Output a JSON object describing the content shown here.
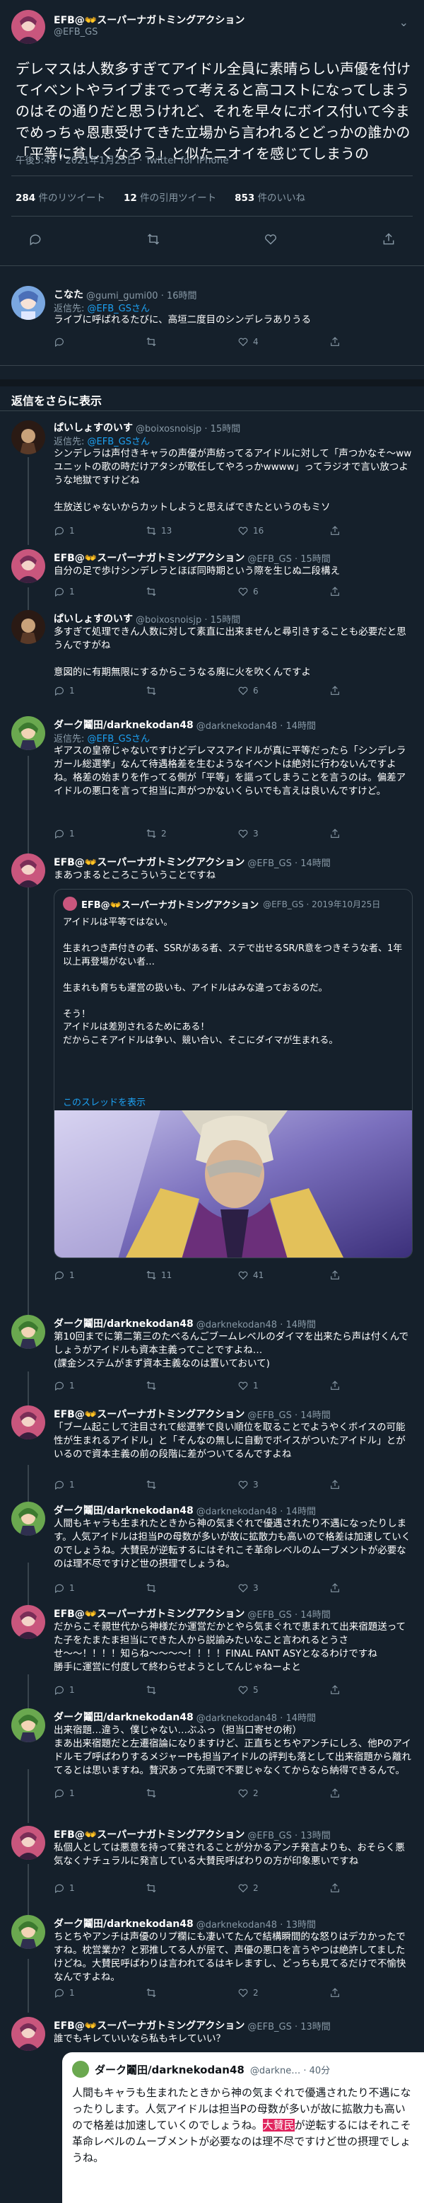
{
  "main": {
    "name": "EFB@👐スーパーナガトミングアクション",
    "handle": "@EFB_GS",
    "text": "デレマスは人数多すぎてアイドル全員に素晴らしい声優を付けてイベントやライブまでって考えると高コストになってしまうのはその通りだと思うけれど、それを早々にボイス付いて今までめっちゃ恩恵受けてきた立場から言われるとどっかの誰かの「平等に貧しくなろう」と似たニオイを感じてしまうの",
    "time": "午後3:40 · 2021年1月25日 · Twitter for iPhone",
    "retweets": "284",
    "retweets_label": "件のリツイート",
    "quotes": "12",
    "quotes_label": "件の引用ツイート",
    "likes": "853",
    "likes_label": "件のいいね"
  },
  "section_title": "返信をさらに表示",
  "replies": [
    {
      "name": "こなた",
      "handle": "@gumi_gumi00 · 16時間",
      "reply_to_label": "返信先:",
      "reply_to": "@EFB_GSさん",
      "text": "ライブに呼ばれるたびに、高垣二度目のシンデレラありうる",
      "reply_count": "",
      "rt_count": "",
      "like_count": "4"
    },
    {
      "name": "ぱいしょすのいす",
      "handle": "@boixosnoisjp · 15時間",
      "reply_to_label": "返信先:",
      "reply_to": "@EFB_GSさん",
      "text": "シンデレラは声付きキャラの声優が声紡ってるアイドルに対して「声つかなそ〜ww ユニットの歌の時だけアタシが歌任してやろっかwwww」ってラジオで言い放つような地獄ですけどね\n\n生放送じゃないからカットしようと思えばできたというのもミソ",
      "reply_count": "1",
      "rt_count": "13",
      "like_count": "16"
    },
    {
      "name": "EFB@👐スーパーナガトミングアクション",
      "handle": "@EFB_GS · 15時間",
      "text": "自分の足で歩けシンデレラとほぼ同時期という際を生じぬ二段構え",
      "reply_count": "1",
      "rt_count": "",
      "like_count": "6"
    },
    {
      "name": "ぱいしょすのいす",
      "handle": "@boixosnoisjp · 15時間",
      "text": "多すぎて処理できん人数に対して素直に出来ませんと尋引きすることも必要だと思うんですがね\n\n意図的に有期無限にするからこうなる廃に火を吹くんですよ",
      "reply_count": "1",
      "rt_count": "",
      "like_count": "6"
    },
    {
      "name": "ダーク鬮田/darknekodan48",
      "handle": "@darknekodan48 · 14時間",
      "reply_to_label": "返信先:",
      "reply_to": "@EFB_GSさん",
      "text": "ギアスの皇帝じゃないですけどデレマスアイドルが真に平等だったら「シンデレラガール総選挙」なんて待遇格差を生むようなイベントは絶対に行わないんですよね。格差の始まりを作ってる側が「平等」を謳ってしまうことを言うのは。偏差アイドルの悪口を言って担当に声がつかないくらいでも言えは良いんですけど。",
      "reply_count": "1",
      "rt_count": "2",
      "like_count": "3"
    },
    {
      "name": "EFB@👐スーパーナガトミングアクション",
      "handle": "@EFB_GS · 14時間",
      "text": "まあつまるところこういうことですね",
      "quote": {
        "name": "EFB@👐スーパーナガトミングアクション",
        "handle": "@EFB_GS · 2019年10月25日",
        "text": "アイドルは平等ではない。\n\n生まれつき声付きの者、SSRがある者、ステで出せるSR/R意をつきそうな者、1年以上再登場がない者…\n\n生まれも育ちも運営の扱いも、アイドルはみな違っておるのだ。\n\nそう！\nアイドルは差別されるためにある！\nだからこそアイドルは争い、競い合い、そこにダイマが生まれる。",
        "thread_link": "このスレッドを表示"
      },
      "reply_count": "1",
      "rt_count": "11",
      "like_count": "41"
    },
    {
      "name": "ダーク鬮田/darknekodan48",
      "handle": "@darknekodan48 · 14時間",
      "text": "第10回までに第二第三のたべるんごブームレベルのダイマを出来たら声は付くんでしょうがアイドルも資本主義ってことですよね…\n(課金システムがまず資本主義なのは置いておいて)",
      "reply_count": "1",
      "rt_count": "",
      "like_count": "1"
    },
    {
      "name": "EFB@👐スーパーナガトミングアクション",
      "handle": "@EFB_GS · 14時間",
      "text": "「ブーム起こして注目されて総選挙で良い順位を取ることでようやくボイスの可能性が生まれるアイドル」と「そんなの無しに自動でボイスがついたアイドル」とがいるので資本主義の前の段階に差がついてるんですよね",
      "reply_count": "1",
      "rt_count": "",
      "like_count": "3"
    },
    {
      "name": "ダーク鬮田/darknekodan48",
      "handle": "@darknekodan48 · 14時間",
      "text": "人間もキャラも生まれたときから神の気まぐれで優遇されたり不遇になったりします。人気アイドルは担当Pの母数が多いが故に拡散力も高いので格差は加速していくのでしょうね。大賛民が逆転するにはそれこそ革命レベルのムーブメントが必要なのは理不尽ですけど世の摂理でしょうね。",
      "reply_count": "1",
      "rt_count": "",
      "like_count": "3"
    },
    {
      "name": "EFB@👐スーパーナガトミングアクション",
      "handle": "@EFB_GS · 14時間",
      "text": "だからこそ親世代から神様だか運営だかとやら気まぐれで恵まれて出来宿題送ってた子をたまたま担当にできた人から説諭みたいなこと言われるとうさせ〜〜！！！！知らね〜〜〜〜！！！！FINAL FANT ASYとなるわけですね\n勝手に運営に付度して終わらせようとしてんじゃねーよと",
      "reply_count": "1",
      "rt_count": "",
      "like_count": "5"
    },
    {
      "name": "ダーク鬮田/darknekodan48",
      "handle": "@darknekodan48 · 14時間",
      "text": "出来宿題…違う、僕じゃない…ぶふっ（担当口寄せの術）\nまあ出来宿題だと左遷宿論になりますけど、正直ちとちやアンチにしろ、他Pのアイドルモブ呼ばわりするメジャーPも担当アイドルの評判も落として出来宿題から離れてるとは思いますね。贅沢あって先頭で不要じゃなくてからなら納得できるんで。",
      "reply_count": "1",
      "rt_count": "",
      "like_count": "2"
    },
    {
      "name": "EFB@👐スーパーナガトミングアクション",
      "handle": "@EFB_GS · 13時間",
      "text": "私個人としては悪意を持って発されることが分かるアンチ発言よりも、おそらく悪気なくナチュラルに発言している大賛民呼ばわりの方が印象悪いですね",
      "reply_count": "1",
      "rt_count": "",
      "like_count": "2"
    },
    {
      "name": "ダーク鬮田/darknekodan48",
      "handle": "@darknekodan48 · 13時間",
      "text": "ちとちやアンチは声優のリプ欄にも凄いてたんで結構瞬間的な怒りはデカかったですね。枕営業か？と邪推してる人が居て、声優の悪口を言うやつは絶許してましたけどね。大賛民呼ばわりは言われてるはキレますし、どっちも見てるだけで不愉快なんですよね。",
      "reply_count": "1",
      "rt_count": "",
      "like_count": "2"
    },
    {
      "name": "EFB@👐スーパーナガトミングアクション",
      "handle": "@EFB_GS · 13時間",
      "text": "誰でもキレていいなら私もキレていい？",
      "quote": {
        "name": "ダーク鬮田/darknekodan48",
        "handle": "@darkne… · 40分",
        "text_before": "人間もキャラも生まれたときから神の気まぐれで優遇されたり不遇になったりします。人気アイドルは担当Pの母数が多いが故に拡散力も高いので格差は加速していくのでしょうね。",
        "highlight": "大賛民",
        "text_after": "が逆転するにはそれこそ革命レベルのムーブメントが必要なのは理不尽ですけど世の摂理でしょうね。"
      },
      "reply_count": "",
      "rt_count": "",
      "like_count": ""
    }
  ],
  "colors": {
    "bg": "#15202b",
    "text": "#ffffff",
    "muted": "#8899a6",
    "link": "#1da1f2",
    "divider": "#38444d",
    "highlight": "#e0245e"
  }
}
